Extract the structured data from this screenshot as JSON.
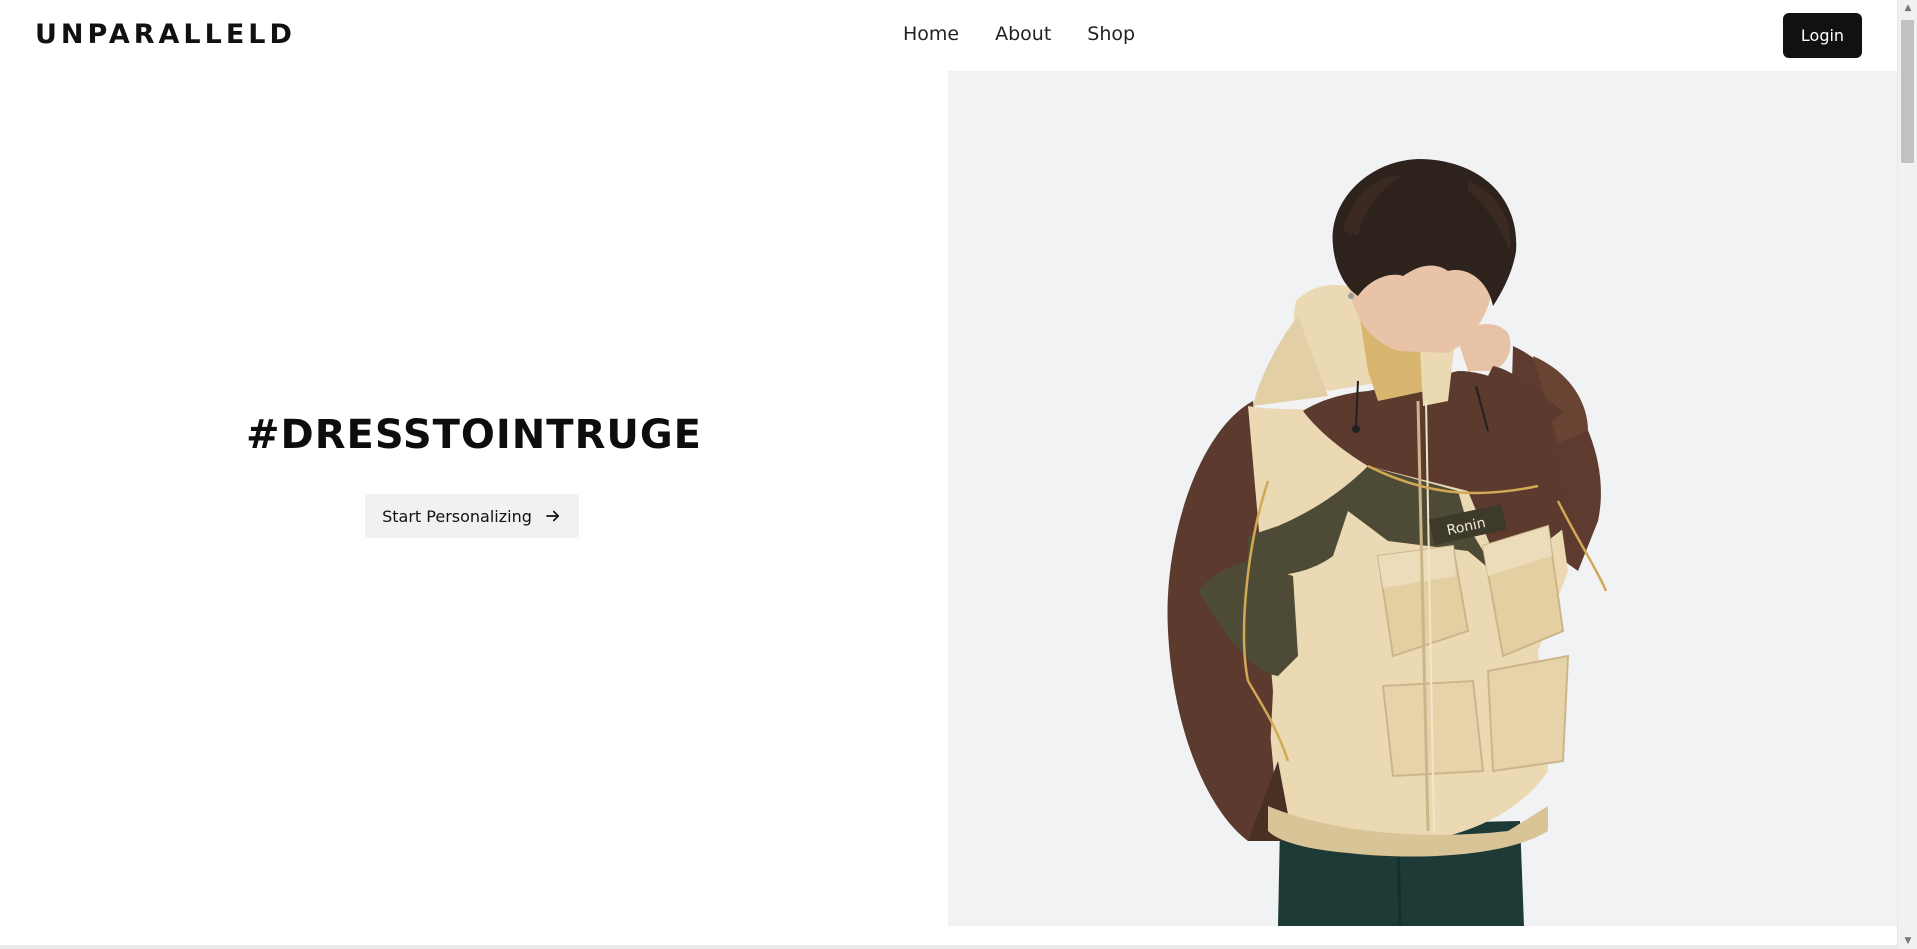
{
  "header": {
    "logo": "UNPARALLELD",
    "nav": [
      "Home",
      "About",
      "Shop"
    ],
    "login_label": "Login"
  },
  "hero": {
    "hashtag": "#DRESSTOINTRUGE",
    "cta_label": "Start Personalizing",
    "image_brand_text": "Ronin"
  },
  "colors": {
    "dark": "#111111",
    "image_bg": "#f1f2f4",
    "jacket_beige": "#ead9b3",
    "jacket_brown": "#5c3a2e",
    "jacket_olive": "#4d4b36",
    "trim": "#d3a855",
    "pants": "#1e3a36"
  },
  "icons": {
    "cta_icon": "arrow-right-icon"
  }
}
